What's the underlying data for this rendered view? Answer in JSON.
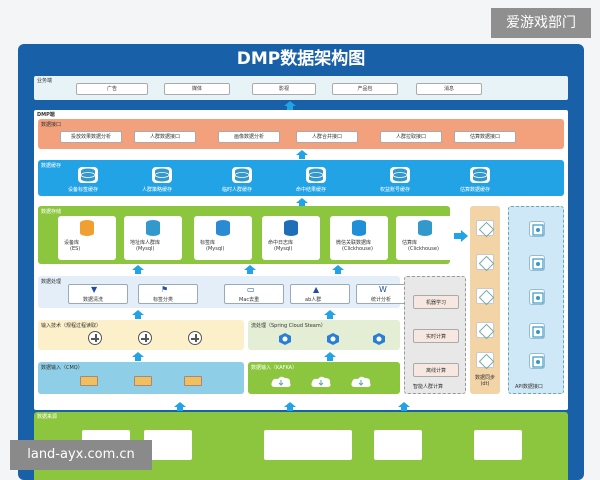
{
  "watermark_top": "爱游戏部门",
  "watermark_bottom": "land-ayx.com.cn",
  "title": "DMP数据架构图",
  "business": {
    "label": "业务端",
    "items": [
      "广告",
      "媒体",
      "影视",
      "产品包",
      "消息"
    ]
  },
  "dmp_label": "DMP端",
  "data_api": {
    "label": "数据接口",
    "items": [
      "投放效果数据分析",
      "人群数据接口",
      "画像数据分析",
      "人群合并接口",
      "人群拉取接口",
      "估算数据接口"
    ]
  },
  "cache": {
    "label": "数据缓存",
    "items": [
      "设备标签缓存",
      "人群策略缓存",
      "临时人群缓存",
      "命中结果缓存",
      "权益账号缓存",
      "估算数据缓存"
    ]
  },
  "storage": {
    "label": "数据存储",
    "items": [
      {
        "name": "设备库",
        "sub": "(ES)"
      },
      {
        "name": "地址库人群库",
        "sub": "(Mysql)"
      },
      {
        "name": "标签库",
        "sub": "(Mysql)"
      },
      {
        "name": "命中日志库",
        "sub": "(Mysql)"
      },
      {
        "name": "微信关联数据库",
        "sub": "(Clickhouse)"
      },
      {
        "name": "估算库",
        "sub": "(Clickhouse)"
      }
    ]
  },
  "processing": {
    "label": "数据处理",
    "items": [
      "数据清洗",
      "标签分类",
      "Mac去重",
      "ab人群",
      "统计分析"
    ]
  },
  "input_tech": {
    "label": "输入技术（规程过程读取）"
  },
  "stream": {
    "label": "流处理（Spring Cloud Steam）"
  },
  "data_input": {
    "label": "数据输入（CMQ）"
  },
  "kafka_input": {
    "label": "数据输入（KAFKA）"
  },
  "smart": {
    "items": [
      "机器学习",
      "实时计算",
      "离线计算"
    ],
    "label": "智能人群计算"
  },
  "sync_label": "数据同步\n(dt)",
  "api_label": "API数据接口",
  "source_label": "数据来源"
}
